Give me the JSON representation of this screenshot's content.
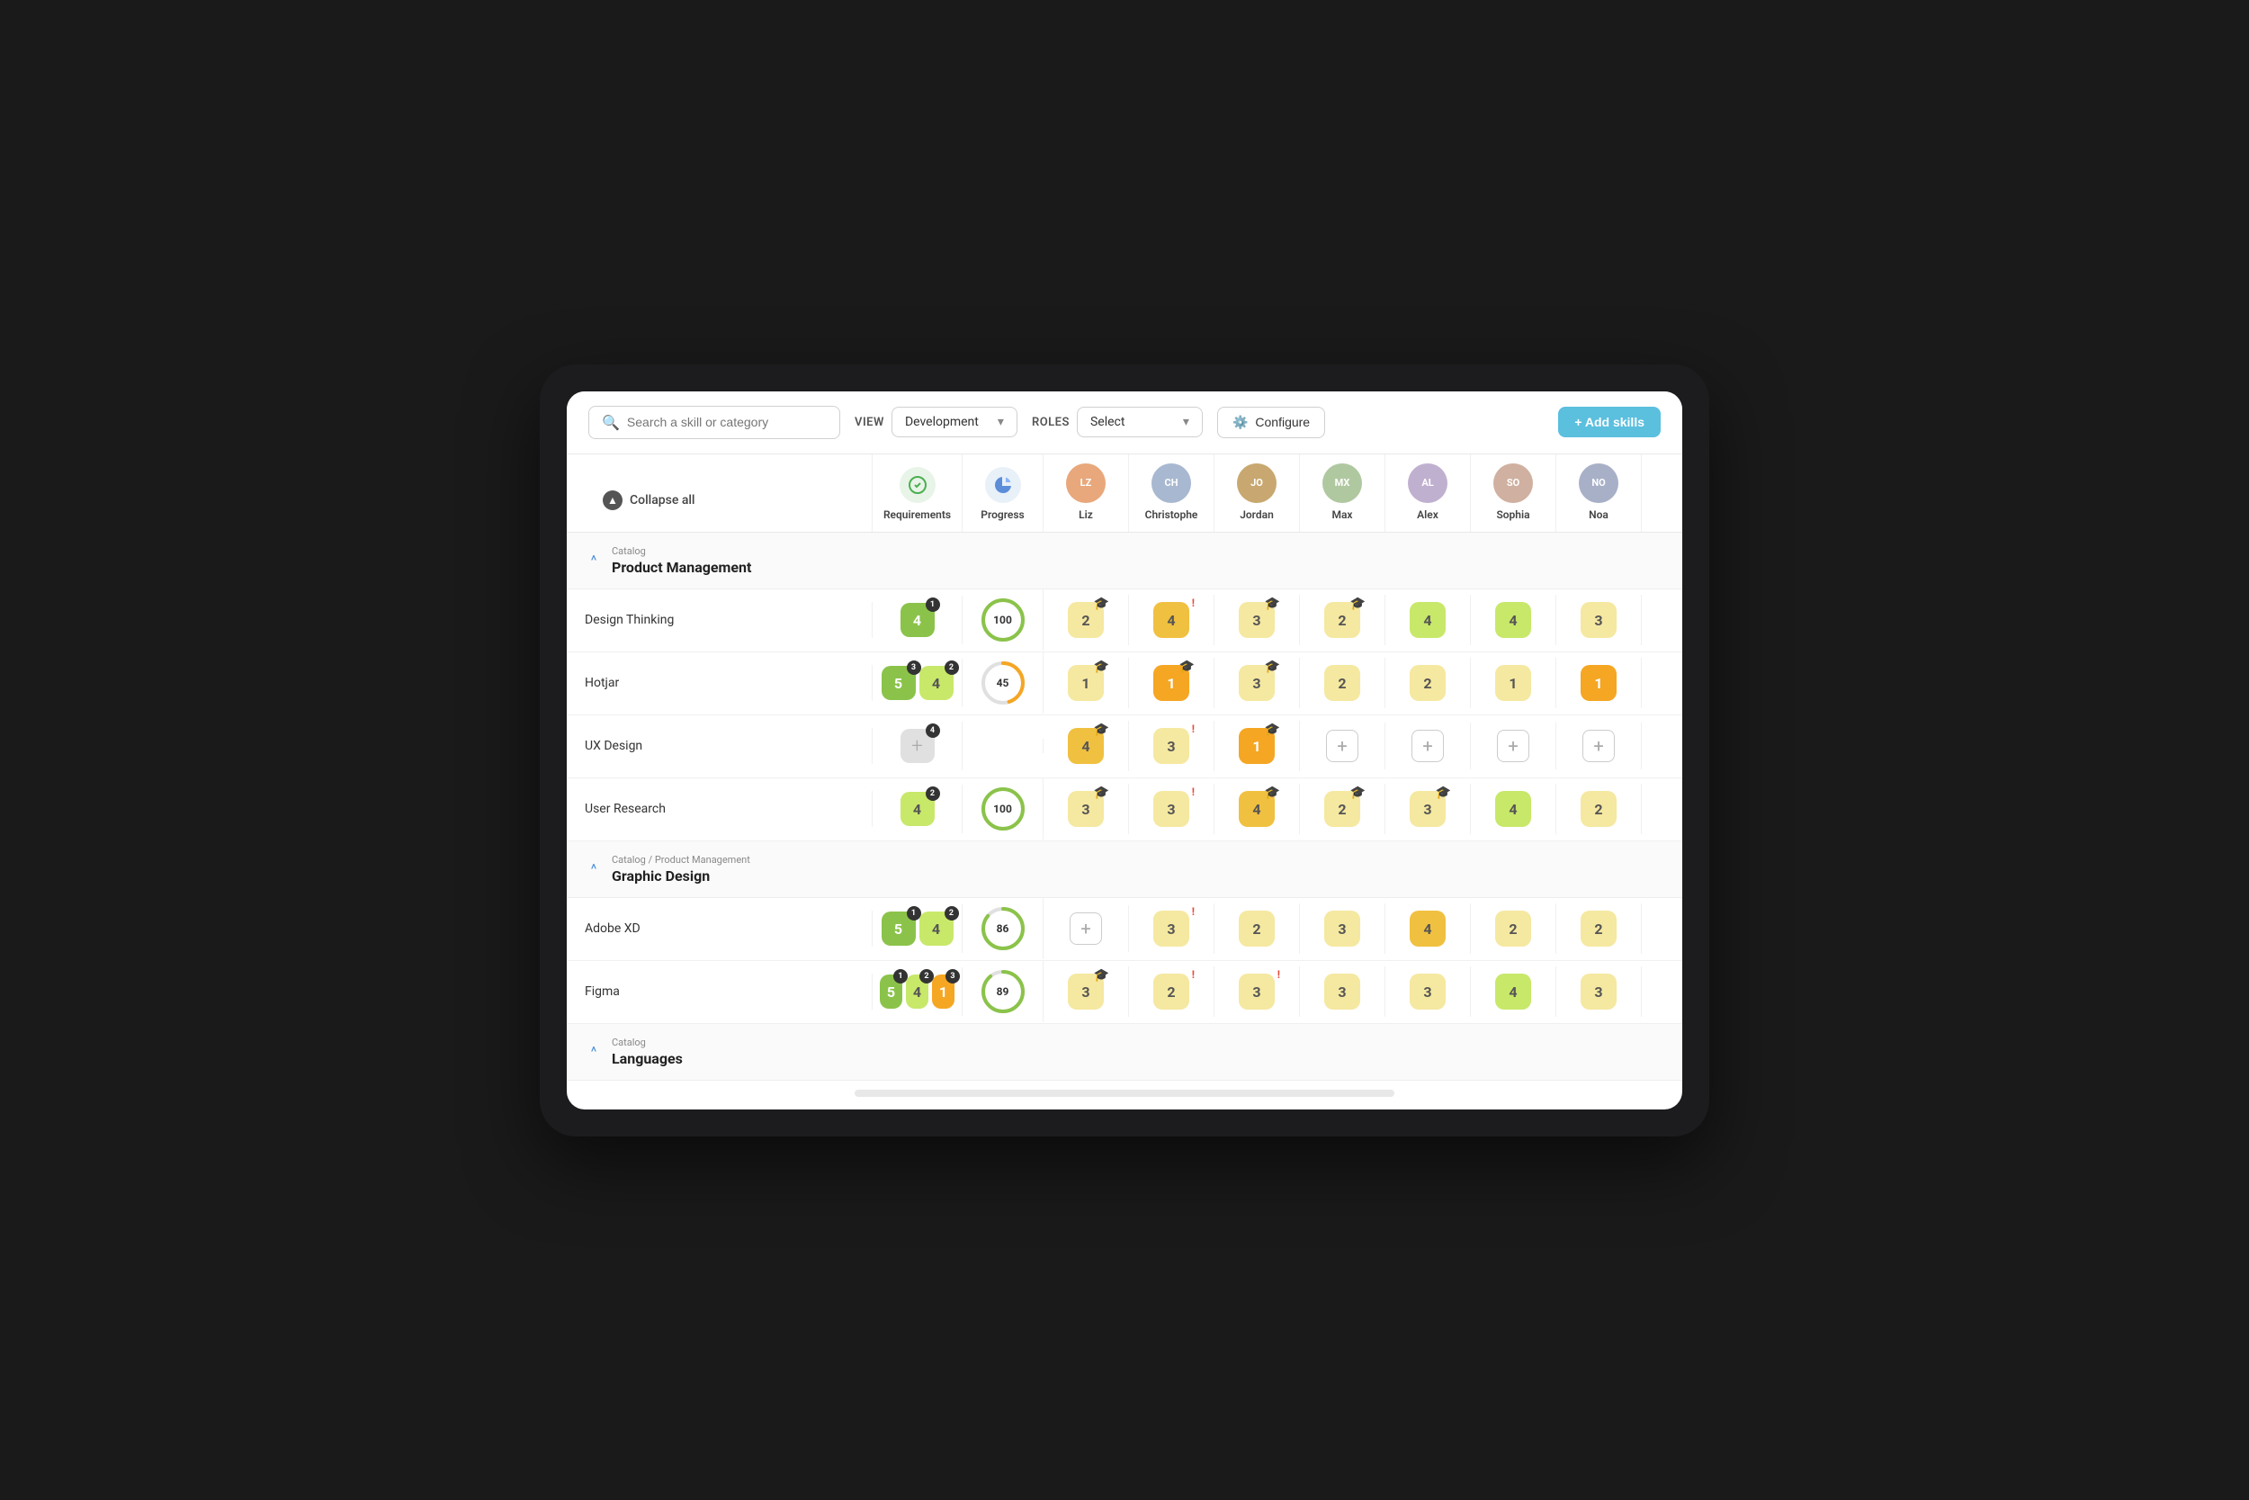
{
  "toolbar": {
    "search_placeholder": "Search a skill or category",
    "view_label": "VIEW",
    "view_value": "Development",
    "roles_label": "ROLES",
    "roles_value": "Select",
    "configure_label": "Configure",
    "add_skills_label": "+ Add skills"
  },
  "table": {
    "collapse_label": "Collapse all",
    "columns": {
      "requirements": "Requirements",
      "progress": "Progress",
      "liz": "Liz",
      "christophe": "Christophe",
      "jordan": "Jordan",
      "max": "Max",
      "alex": "Alex",
      "sophia": "Sophia",
      "noa": "Noa"
    }
  },
  "sections": [
    {
      "id": "product-management",
      "breadcrumb": "Catalog",
      "title": "Product Management",
      "skills": [
        {
          "name": "Design Thinking",
          "req": [
            {
              "val": "4",
              "color": "green",
              "count": "1"
            }
          ],
          "progress": 100,
          "progress_color": "#8bc34a",
          "scores": [
            {
              "val": "2",
              "color": "yellow-light",
              "cap": true
            },
            {
              "val": "4",
              "color": "yellow",
              "alert": true
            },
            {
              "val": "3",
              "color": "yellow-light",
              "cap": true
            },
            {
              "val": "2",
              "color": "yellow-light",
              "cap": true
            },
            {
              "val": "4",
              "color": "green-light"
            },
            {
              "val": "4",
              "color": "green-light"
            },
            {
              "val": "3",
              "color": "yellow-light"
            }
          ]
        },
        {
          "name": "Hotjar",
          "req": [
            {
              "val": "5",
              "color": "green",
              "count": "3"
            },
            {
              "val": "4",
              "color": "green-light",
              "count": "2"
            }
          ],
          "progress": 45,
          "progress_color": "#f5a623",
          "scores": [
            {
              "val": "1",
              "color": "yellow-light",
              "cap": true
            },
            {
              "val": "1",
              "color": "orange",
              "cap": true
            },
            {
              "val": "3",
              "color": "yellow-light",
              "cap": true
            },
            {
              "val": "2",
              "color": "yellow-light"
            },
            {
              "val": "2",
              "color": "yellow-light"
            },
            {
              "val": "1",
              "color": "yellow-light"
            },
            {
              "val": "1",
              "color": "orange"
            }
          ]
        },
        {
          "name": "UX Design",
          "req": [
            {
              "val": "+",
              "color": "gray",
              "count": "4"
            }
          ],
          "progress": null,
          "scores": [
            {
              "val": "4",
              "color": "yellow",
              "cap": true
            },
            {
              "val": "3",
              "color": "yellow-light",
              "alert": true
            },
            {
              "val": "1",
              "color": "orange",
              "cap": true
            },
            {
              "val": "+",
              "color": "plus"
            },
            {
              "val": "+",
              "color": "plus"
            },
            {
              "val": "+",
              "color": "plus"
            },
            {
              "val": "+",
              "color": "plus"
            }
          ]
        },
        {
          "name": "User Research",
          "req": [
            {
              "val": "4",
              "color": "green-light",
              "count": "2"
            }
          ],
          "progress": 100,
          "progress_color": "#8bc34a",
          "scores": [
            {
              "val": "3",
              "color": "yellow-light",
              "cap": true
            },
            {
              "val": "3",
              "color": "yellow-light",
              "alert": true
            },
            {
              "val": "4",
              "color": "yellow",
              "cap": true
            },
            {
              "val": "2",
              "color": "yellow-light",
              "cap": true
            },
            {
              "val": "3",
              "color": "yellow-light",
              "cap": true
            },
            {
              "val": "4",
              "color": "green-light"
            },
            {
              "val": "2",
              "color": "yellow-light"
            }
          ]
        }
      ]
    },
    {
      "id": "graphic-design",
      "breadcrumb": "Catalog / Product Management",
      "title": "Graphic Design",
      "skills": [
        {
          "name": "Adobe XD",
          "req": [
            {
              "val": "5",
              "color": "green",
              "count": "1"
            },
            {
              "val": "4",
              "color": "green-light",
              "count": "2"
            }
          ],
          "progress": 86,
          "progress_color": "#8bc34a",
          "scores": [
            {
              "val": "+",
              "color": "plus"
            },
            {
              "val": "3",
              "color": "yellow-light",
              "alert": true
            },
            {
              "val": "2",
              "color": "yellow-light"
            },
            {
              "val": "3",
              "color": "yellow-light"
            },
            {
              "val": "4",
              "color": "yellow"
            },
            {
              "val": "2",
              "color": "yellow-light"
            },
            {
              "val": "2",
              "color": "yellow-light"
            }
          ]
        },
        {
          "name": "Figma",
          "req": [
            {
              "val": "5",
              "color": "green",
              "count": "1"
            },
            {
              "val": "4",
              "color": "green-light",
              "count": "2"
            },
            {
              "val": "1",
              "color": "orange",
              "count": "3"
            }
          ],
          "progress": 89,
          "progress_color": "#8bc34a",
          "scores": [
            {
              "val": "3",
              "color": "yellow-light",
              "cap": true
            },
            {
              "val": "2",
              "color": "yellow-light",
              "alert": true
            },
            {
              "val": "3",
              "color": "yellow-light",
              "alert": true
            },
            {
              "val": "3",
              "color": "yellow-light"
            },
            {
              "val": "3",
              "color": "yellow-light"
            },
            {
              "val": "4",
              "color": "green-light"
            },
            {
              "val": "3",
              "color": "yellow-light"
            }
          ]
        }
      ]
    },
    {
      "id": "languages",
      "breadcrumb": "Catalog",
      "title": "Languages",
      "skills": []
    }
  ]
}
